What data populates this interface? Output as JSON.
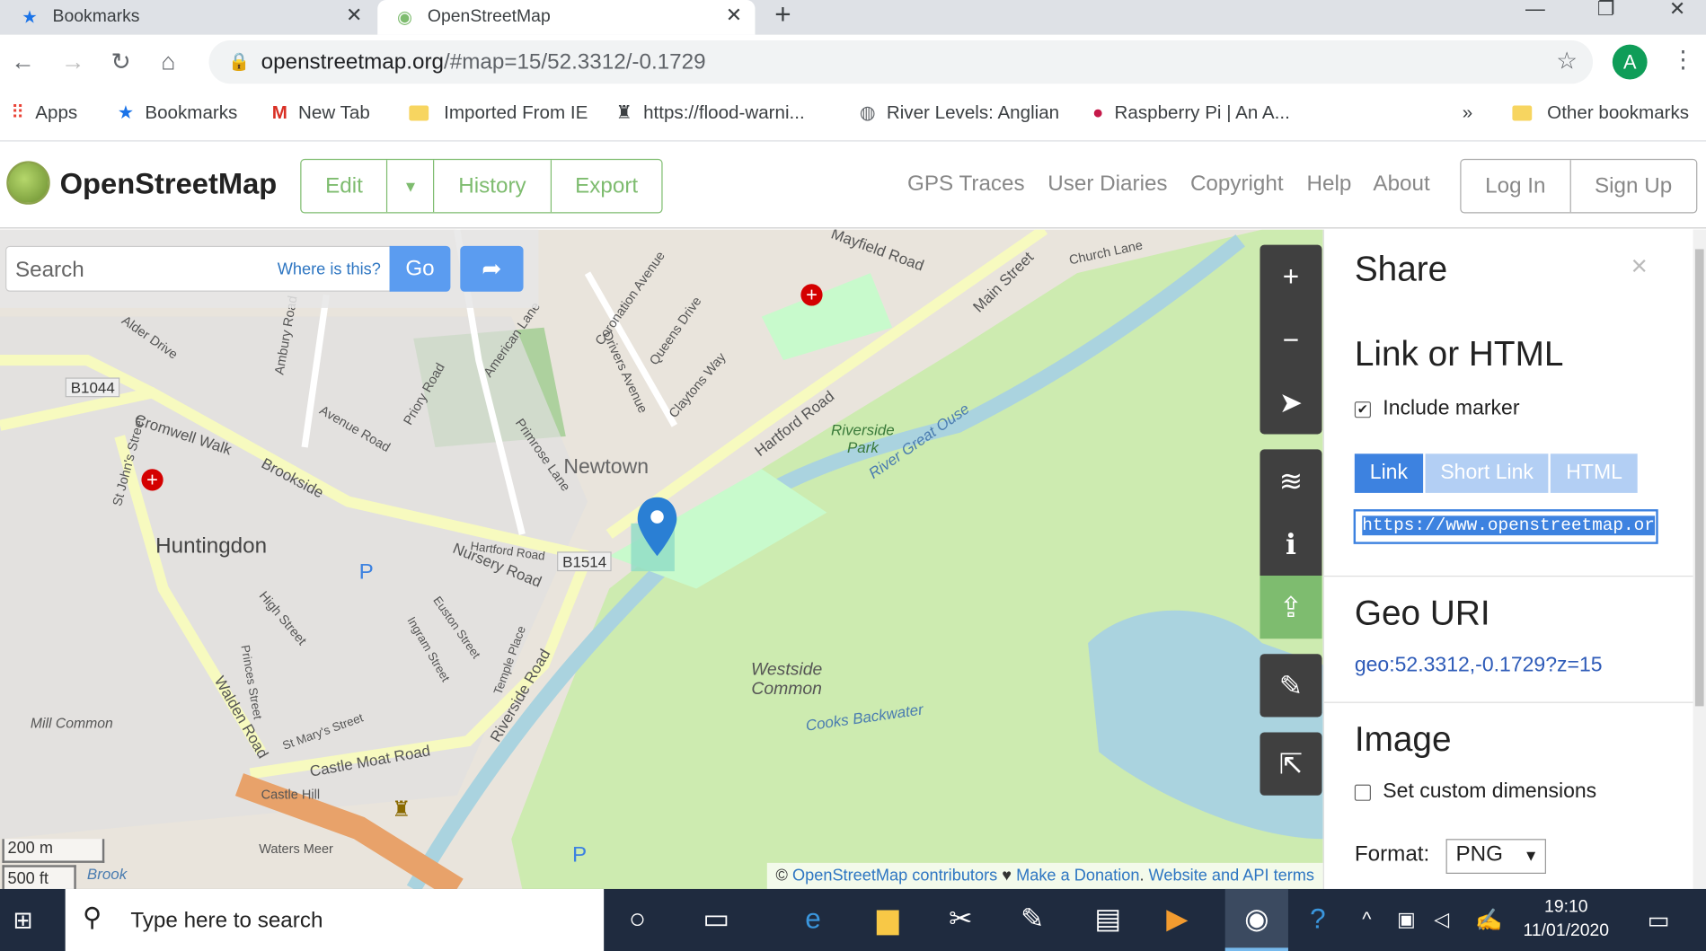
{
  "browser": {
    "tabs": [
      {
        "label": "Bookmarks",
        "icon": "star-icon"
      },
      {
        "label": "OpenStreetMap",
        "icon": "osm-logo-icon"
      }
    ],
    "url_host": "openstreetmap.org",
    "url_path": "/#map=15/52.3312/-0.1729",
    "avatar": "A",
    "bookmarks": [
      {
        "label": "Apps",
        "icon": "apps-grid-icon"
      },
      {
        "label": "Bookmarks",
        "icon": "star-icon"
      },
      {
        "label": "New Tab",
        "icon": "gmail-icon"
      },
      {
        "label": "Imported From IE",
        "icon": "folder-icon"
      },
      {
        "label": "https://flood-warni...",
        "icon": "site-icon"
      },
      {
        "label": "River Levels: Anglian",
        "icon": "globe-icon"
      },
      {
        "label": "Raspberry Pi | An A...",
        "icon": "raspberry-icon"
      },
      {
        "label": "Other bookmarks",
        "icon": "folder-icon"
      }
    ],
    "more": "»"
  },
  "osm": {
    "brand": "OpenStreetMap",
    "edit": "Edit",
    "history": "History",
    "export": "Export",
    "nav": [
      "GPS Traces",
      "User Diaries",
      "Copyright",
      "Help",
      "About"
    ],
    "login": "Log In",
    "signup": "Sign Up"
  },
  "search": {
    "placeholder": "Search",
    "where": "Where is this?",
    "go": "Go"
  },
  "map": {
    "labels": [
      "Huntingdon",
      "Newtown",
      "Riverside Park",
      "River Great Ouse",
      "Westside Common",
      "Cooks Backwater",
      "Hartford Road",
      "Main Street",
      "Mayfield Road",
      "Church Lane",
      "Brookside",
      "Cromwell Walk",
      "Nursery Road",
      "Castle Moat Road",
      "Riverside Road",
      "Walden Road",
      "B1044",
      "B1514",
      "Mill Common",
      "Castle Hill",
      "Primrose Lane",
      "High Street",
      "Waters Meer",
      "Brook",
      "Avenue Road",
      "Priory Road",
      "American Lane",
      "Coronation Avenue",
      "Queens Drive",
      "Claytons Way",
      "Drivers Avenue",
      "Alder Drive",
      "Ambury Road",
      "Princes Street",
      "Ingram Street",
      "Euston Street",
      "Temple Place",
      "St Mary's Street",
      "St John's Street",
      "Hartford Road"
    ],
    "scale_m": "200 m",
    "scale_ft": "500 ft",
    "attrib_c": "© ",
    "attrib_contrib": "OpenStreetMap contributors",
    "attrib_heart": " ♥ ",
    "attrib_donate": "Make a Donation",
    "attrib_dot": ". ",
    "attrib_terms": "Website and API terms"
  },
  "share": {
    "title": "Share",
    "close": "×",
    "link_heading": "Link or HTML",
    "include_marker": "Include marker",
    "tabs": [
      "Link",
      "Short Link",
      "HTML"
    ],
    "link_value": "https://www.openstreetmap.or",
    "geo_heading": "Geo URI",
    "geo_uri": "geo:52.3312,-0.1729?z=15",
    "image_heading": "Image",
    "custom_dims": "Set custom dimensions",
    "format_label": "Format:",
    "format_value": "PNG"
  },
  "taskbar": {
    "search_text": "Type here to search",
    "time": "19:10",
    "date": "11/01/2020"
  }
}
